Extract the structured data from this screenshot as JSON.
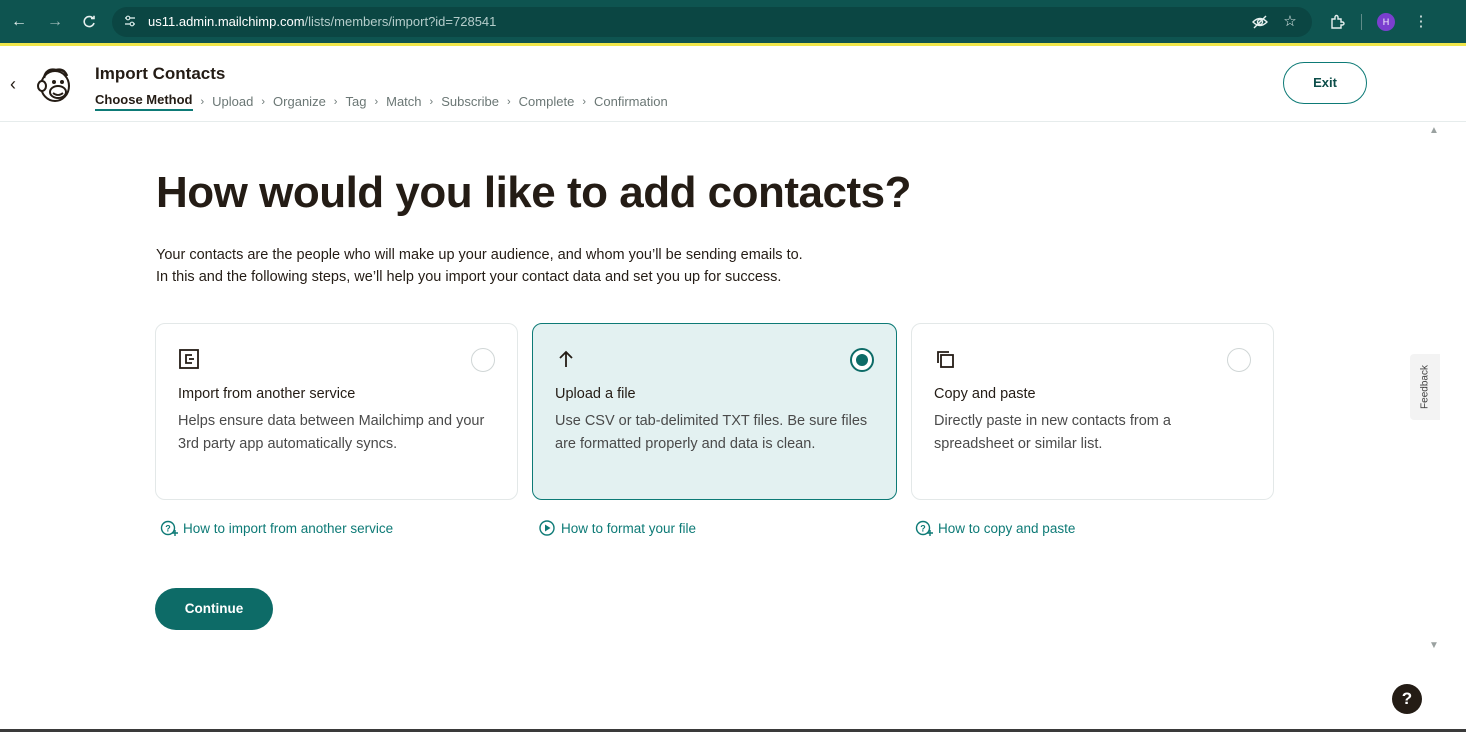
{
  "browser": {
    "url_host": "us11.admin.mailchimp.com",
    "url_path": "/lists/members/import?id=728541",
    "profile_initial": "H",
    "icons": [
      "back-arrow-icon",
      "forward-arrow-icon",
      "reload-icon",
      "site-settings-icon",
      "eye-off-icon",
      "star-icon",
      "extensions-icon",
      "kebab-menu-icon"
    ]
  },
  "header": {
    "title": "Import Contacts",
    "steps": [
      {
        "label": "Choose Method",
        "active": true
      },
      {
        "label": "Upload"
      },
      {
        "label": "Organize"
      },
      {
        "label": "Tag"
      },
      {
        "label": "Match"
      },
      {
        "label": "Subscribe"
      },
      {
        "label": "Complete"
      },
      {
        "label": "Confirmation"
      }
    ],
    "exit_label": "Exit"
  },
  "main": {
    "heading": "How would you like to add contacts?",
    "description_line1": "Your contacts are the people who will make up your audience, and whom you’ll be sending emails to.",
    "description_line2": "In this and the following steps, we’ll help you import your contact data and set you up for success.",
    "options": [
      {
        "title": "Import from another service",
        "text": "Helps ensure data between Mailchimp and your 3rd party app automatically syncs.",
        "icon": "import-service-icon",
        "selected": false,
        "help_link": "How to import from another service"
      },
      {
        "title": "Upload a file",
        "text": "Use CSV or tab-delimited TXT files. Be sure files are formatted properly and data is clean.",
        "icon": "upload-arrow-icon",
        "selected": true,
        "help_link": "How to format your file"
      },
      {
        "title": "Copy and paste",
        "text": "Directly paste in new contacts from a spreadsheet or similar list.",
        "icon": "copy-icon",
        "selected": false,
        "help_link": "How to copy and paste"
      }
    ],
    "continue_label": "Continue"
  },
  "feedback_label": "Feedback",
  "help_label": "?",
  "colors": {
    "chrome": "#0e5450",
    "accent": "#0d6b67",
    "selected_card_bg": "#e3f1f1"
  }
}
